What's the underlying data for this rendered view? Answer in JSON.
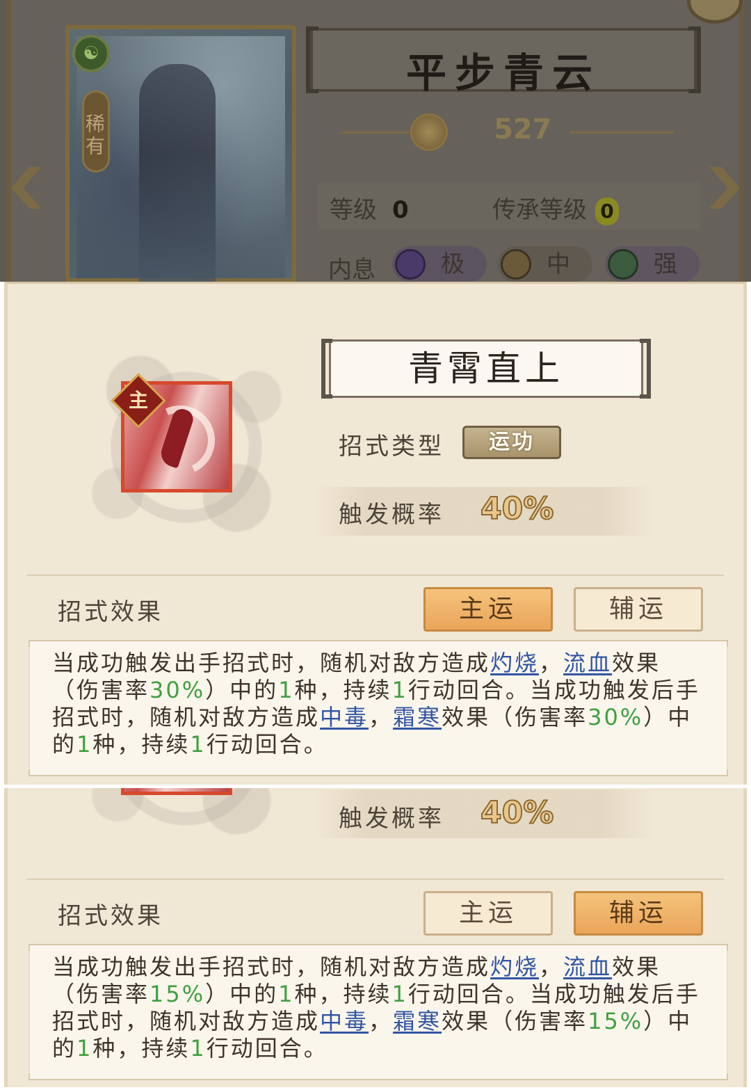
{
  "hero": {
    "name": "平步青云",
    "rarity": "稀有",
    "power": "527",
    "level_label": "等级",
    "level_value": "0",
    "inherit_label": "传承等级",
    "inherit_value": "0",
    "breath_label": "内息",
    "breaths": [
      {
        "label": "极",
        "color": "#4a3a6a"
      },
      {
        "label": "中",
        "color": "#6a5a3a"
      },
      {
        "label": "强",
        "color": "#3c5a3e"
      }
    ]
  },
  "skill": {
    "name": "青霄直上",
    "main_tag": "主",
    "type_label": "招式类型",
    "type_value": "运功",
    "trigger_label": "触发概率",
    "trigger_value": "40%",
    "effect_label": "招式效果",
    "tab_main": "主运",
    "tab_assist": "辅运"
  },
  "panels": [
    {
      "active_tab": "主运",
      "description": {
        "p1": "当成功触发出手招式时，随机对敌方造成",
        "burn": "灼烧",
        "sep1": "，",
        "bleed": "流血",
        "p2": "效果（伤害率",
        "rate1": "30%",
        "p3": "）中的",
        "n1": "1",
        "p4": "种，持续",
        "n2": "1",
        "p5": "行动回合。当成功触发后手招式时，随机对敌方造成",
        "poison": "中毒",
        "sep2": "，",
        "frost": "霜寒",
        "p6": "效果（伤害率",
        "rate2": "30%",
        "p7": "）中的",
        "n3": "1",
        "p8": "种，持续",
        "n4": "1",
        "p9": "行动回合。"
      }
    },
    {
      "active_tab": "辅运",
      "description": {
        "p1": "当成功触发出手招式时，随机对敌方造成",
        "burn": "灼烧",
        "sep1": "，",
        "bleed": "流血",
        "p2": "效果（伤害率",
        "rate1": "15%",
        "p3": "）中的",
        "n1": "1",
        "p4": "种，持续",
        "n2": "1",
        "p5": "行动回合。当成功触发后手招式时，随机对敌方造成",
        "poison": "中毒",
        "sep2": "，",
        "frost": "霜寒",
        "p6": "效果（伤害率",
        "rate2": "15%",
        "p7": "）中的",
        "n3": "1",
        "p8": "种，持续",
        "n4": "1",
        "p9": "行动回合。"
      }
    }
  ],
  "colors": {
    "link": "#3155a4",
    "number": "#3fa041",
    "tab_active": "#eaa55a",
    "icon_border": "#d6492d"
  }
}
